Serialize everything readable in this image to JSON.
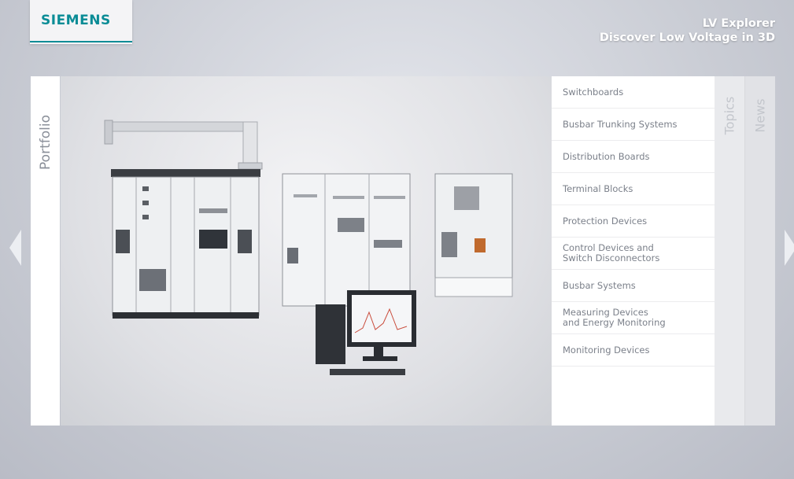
{
  "brand": {
    "logo": "SIEMENS"
  },
  "app": {
    "title_line1": "LV Explorer",
    "title_line2": "Discover Low Voltage in 3D"
  },
  "tabs": {
    "portfolio": "Portfolio",
    "topics": "Topics",
    "news": "News"
  },
  "menu": {
    "items": [
      {
        "label": "Switchboards"
      },
      {
        "label": "Busbar Trunking Systems"
      },
      {
        "label": "Distribution Boards"
      },
      {
        "label": "Terminal Blocks"
      },
      {
        "label": "Protection Devices"
      },
      {
        "label": "Control Devices and",
        "label2": "Switch Disconnectors"
      },
      {
        "label": "Busbar Systems"
      },
      {
        "label": "Measuring Devices",
        "label2": "and Energy Monitoring"
      },
      {
        "label": "Monitoring Devices"
      }
    ]
  },
  "colors": {
    "brand_teal": "#0a8c96",
    "menu_text": "#7b808a",
    "tab_text": "#c3c6cc"
  },
  "icons": {
    "prev": "chevron-left-icon",
    "next": "chevron-right-icon"
  }
}
